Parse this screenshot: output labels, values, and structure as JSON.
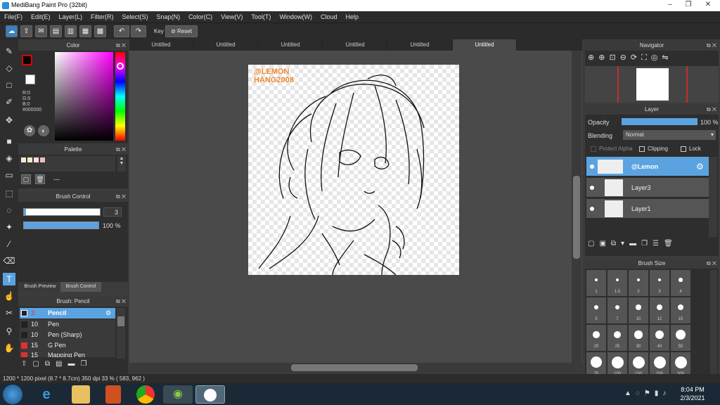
{
  "window": {
    "title": "MediBang Paint Pro (32bit)"
  },
  "menu": [
    "File(F)",
    "Edit(E)",
    "Layer(L)",
    "Filter(R)",
    "Select(S)",
    "Snap(N)",
    "Color(C)",
    "View(V)",
    "Tool(T)",
    "Window(W)",
    "Cloud",
    "Help"
  ],
  "toolbar": {
    "key_label": "Key",
    "reset_label": "Reset"
  },
  "tabs": [
    "Untitled",
    "Untitled",
    "Untitled",
    "Untitled",
    "Untitled",
    "Untitled"
  ],
  "color_panel": {
    "title": "Color",
    "r": "R:0",
    "g": "G:0",
    "b": "B:0",
    "hex": "#000000"
  },
  "palette_panel": {
    "title": "Palette",
    "dash": "---"
  },
  "brush_control": {
    "title": "Brush Control",
    "size": "3",
    "opacity": "100 %",
    "size_fill": 0.97,
    "opacity_fill": 1.0
  },
  "brush_tabs": {
    "preview": "Brush Preview",
    "control": "Brush Control"
  },
  "brush_panel": {
    "title": "Brush: Pencil",
    "items": [
      {
        "size": "3",
        "name": "Pencil",
        "color": "#222222"
      },
      {
        "size": "10",
        "name": "Pen",
        "color": "#222222"
      },
      {
        "size": "10",
        "name": "Pen (Sharp)",
        "color": "#222222"
      },
      {
        "size": "15",
        "name": "G Pen",
        "color": "#e03030"
      },
      {
        "size": "15",
        "name": "Mapping Pen",
        "color": "#e03030"
      }
    ]
  },
  "watermark": {
    "line1": "@LEMON",
    "line2": "HANG2008"
  },
  "navigator": {
    "title": "Navigator"
  },
  "layer_panel": {
    "title": "Layer",
    "opacity_label": "Opacity",
    "opacity_value": "100 %",
    "blending_label": "Blending",
    "blending_value": "Normal",
    "protect_alpha": "Protect Alpha",
    "clipping": "Clipping",
    "lock": "Lock",
    "layers": [
      "@Lemon",
      "Layer3",
      "Layer1"
    ]
  },
  "brush_size": {
    "title": "Brush Size",
    "sizes": [
      "1",
      "1.5",
      "2",
      "3",
      "4",
      "5",
      "7",
      "10",
      "12",
      "15",
      "20",
      "25",
      "30",
      "40",
      "50",
      "70",
      "100",
      "150",
      "200",
      "300"
    ]
  },
  "status": {
    "text": "1200 * 1200 pixel   (8.7 * 8.7cm)   350 dpi   33 %   ( 583, 962 )"
  },
  "taskbar": {
    "time": "8:04 PM",
    "date": "2/3/2021"
  },
  "colors": {
    "accent": "#5ba3e0",
    "fg_color": "#000000",
    "watermark": "#f08a30"
  }
}
